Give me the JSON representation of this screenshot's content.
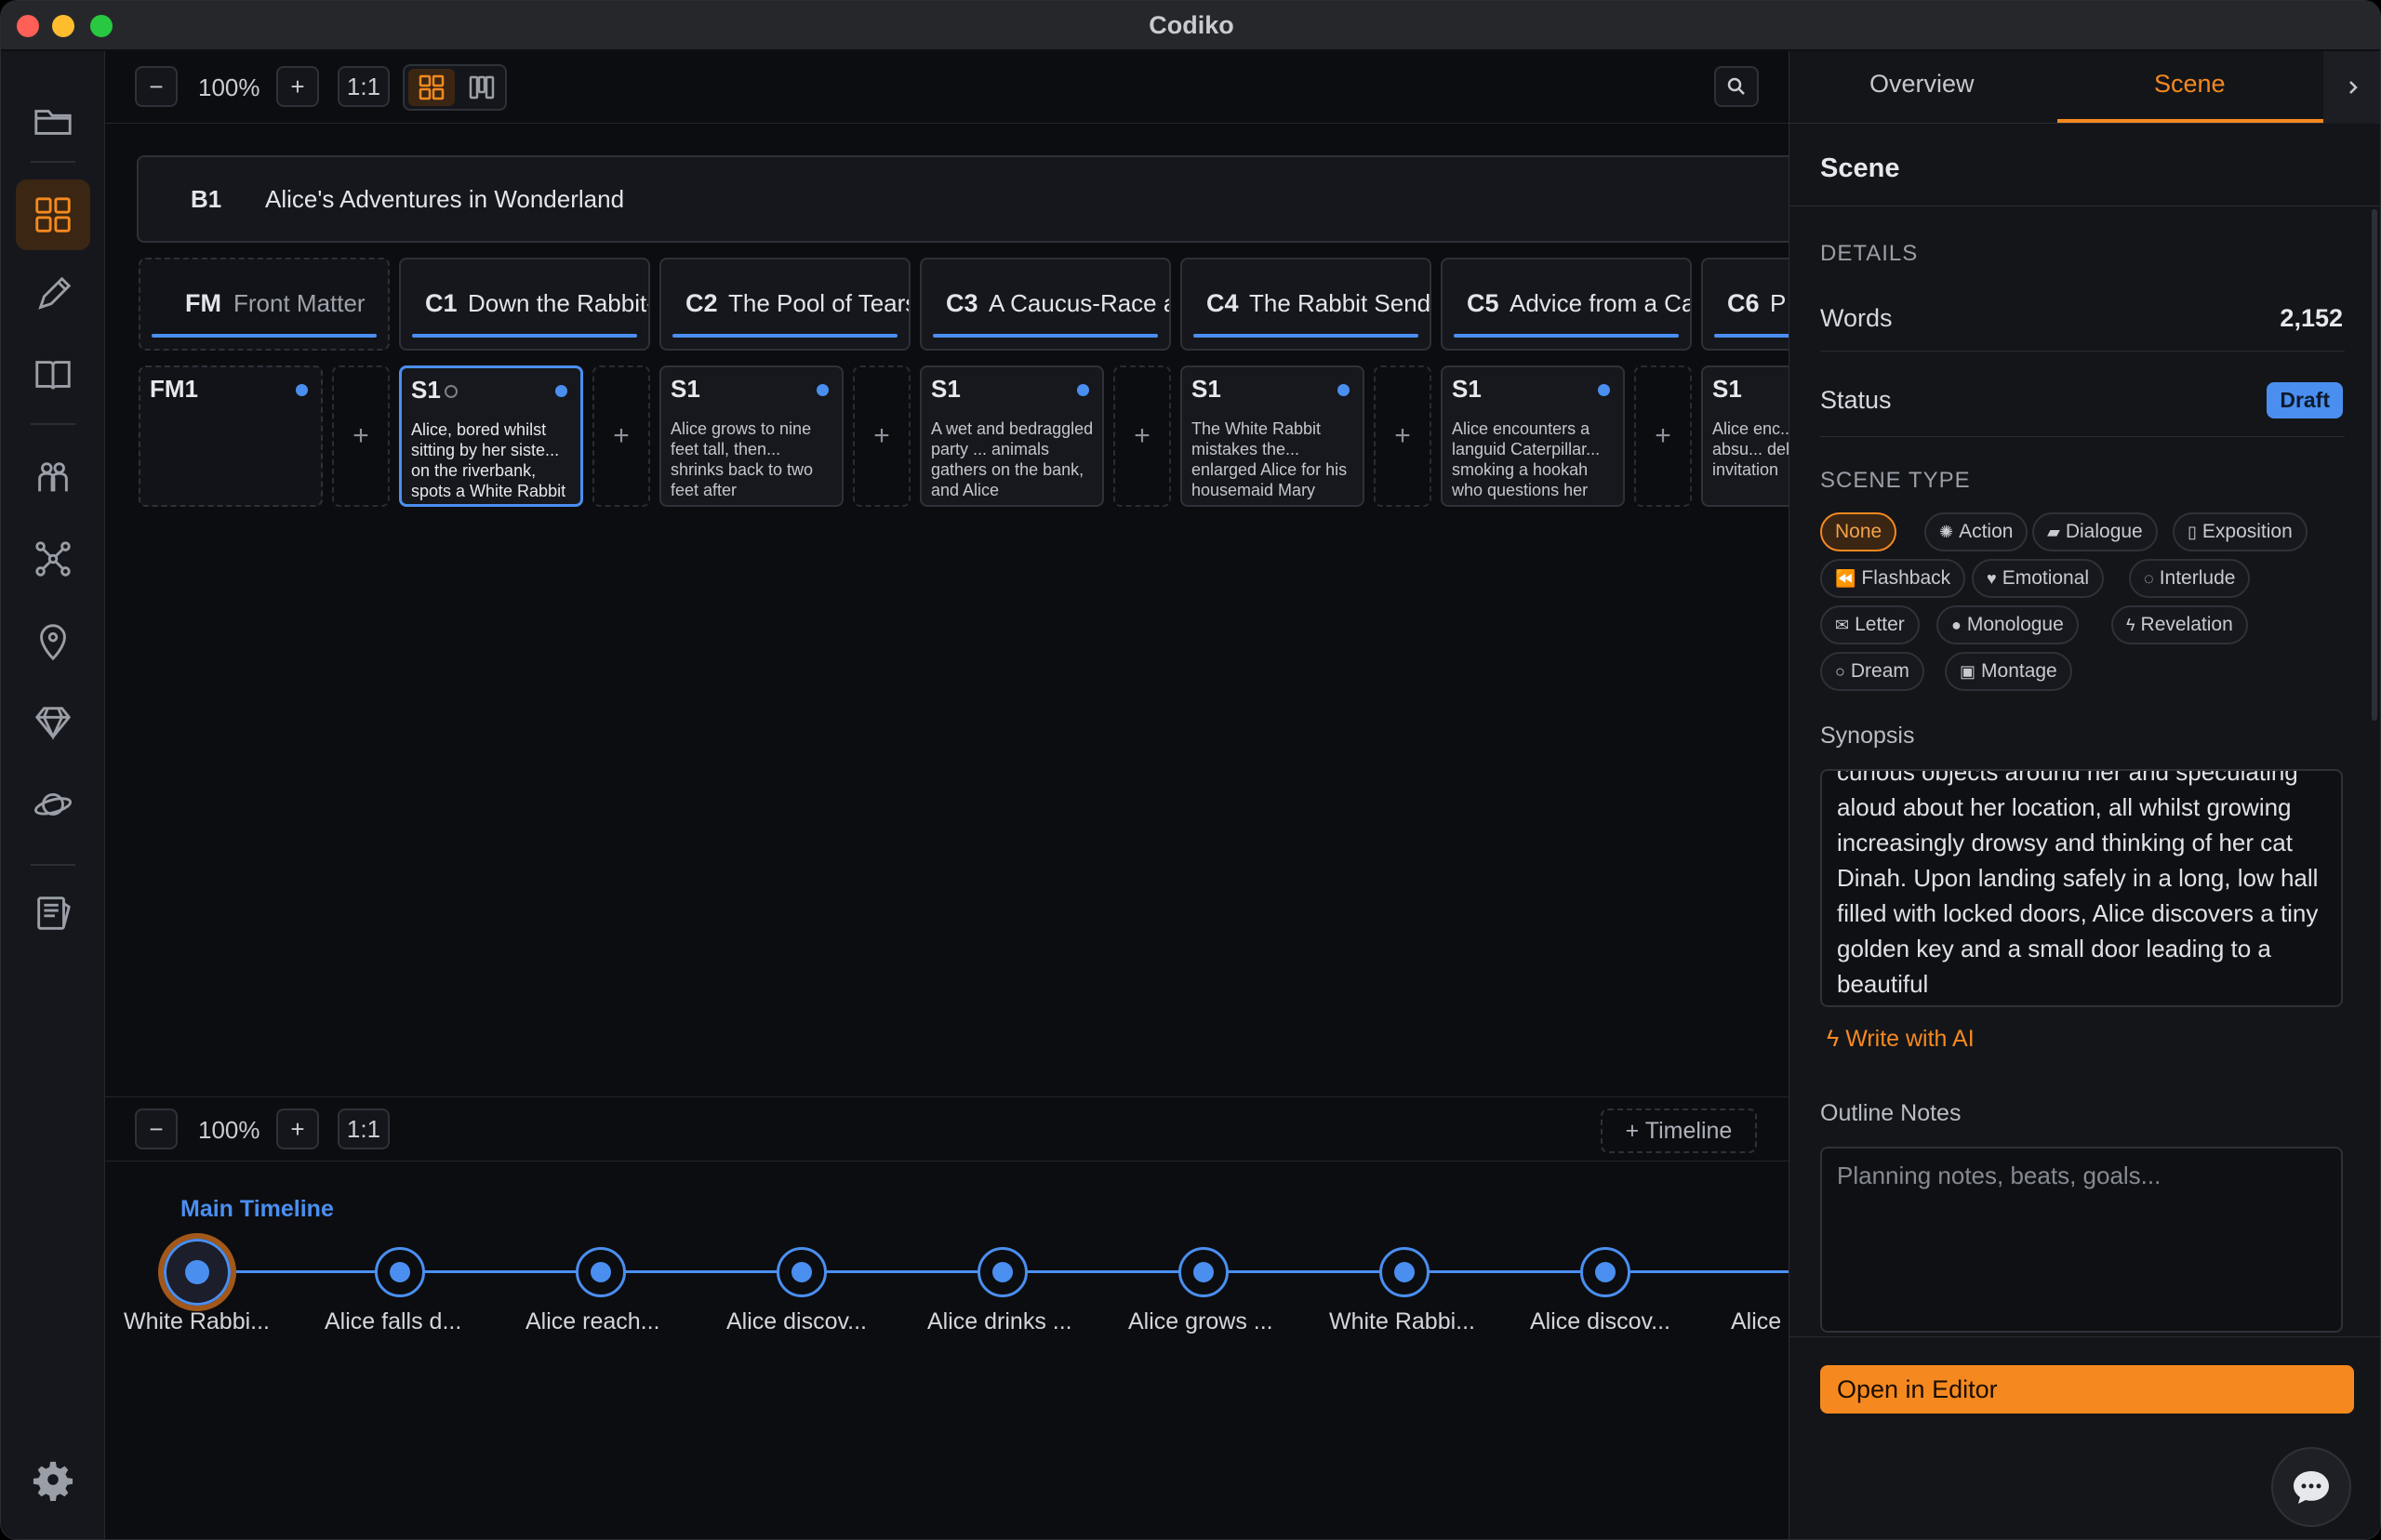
{
  "app": {
    "title": "Codiko"
  },
  "sidebar": {
    "items": [
      {
        "icon": "folder-icon"
      },
      {
        "icon": "grid-icon",
        "active": true
      },
      {
        "icon": "pencil-icon"
      },
      {
        "icon": "book-icon"
      },
      {
        "icon": "characters-icon"
      },
      {
        "icon": "graph-icon"
      },
      {
        "icon": "location-icon"
      },
      {
        "icon": "gem-icon"
      },
      {
        "icon": "planet-icon"
      },
      {
        "icon": "notes-icon"
      },
      {
        "icon": "settings-icon"
      }
    ]
  },
  "toolbar": {
    "zoom_out": "−",
    "zoom": "100%",
    "zoom_in": "+",
    "reset": "1:1"
  },
  "book": {
    "tag": "B1",
    "title": "Alice's Adventures in Wonderland"
  },
  "chapters": [
    {
      "tag": "FM",
      "title": "Front Matter"
    },
    {
      "tag": "C1",
      "title": "Down the Rabbit-Hole"
    },
    {
      "tag": "C2",
      "title": "The Pool of Tears"
    },
    {
      "tag": "C3",
      "title": "A Caucus-Race and a Long Tale"
    },
    {
      "tag": "C4",
      "title": "The Rabbit Sends in a Little Bill"
    },
    {
      "tag": "C5",
      "title": "Advice from a Caterpillar"
    },
    {
      "tag": "C6",
      "title": "P"
    }
  ],
  "scenes": [
    {
      "tag": "FM1",
      "text": ""
    },
    {
      "tag": "S1",
      "text": "Alice, bored whilst sitting by her siste... on the riverbank, spots a White Rabbit"
    },
    {
      "tag": "S1",
      "text": "Alice grows to nine feet tall, then... shrinks back to two feet after"
    },
    {
      "tag": "S1",
      "text": "A wet and bedraggled party ... animals gathers on the bank, and Alice"
    },
    {
      "tag": "S1",
      "text": "The White Rabbit mistakes the... enlarged Alice for his housemaid Mary"
    },
    {
      "tag": "S1",
      "text": "Alice encounters a languid Caterpillar... smoking a hookah who questions her"
    },
    {
      "tag": "S1",
      "text": "Alice enc... two absu... delivering invitation"
    }
  ],
  "adder_label": "+",
  "bottom": {
    "zoom_out": "−",
    "zoom": "100%",
    "zoom_in": "+",
    "reset": "1:1",
    "add_timeline": "+ Timeline"
  },
  "timeline": {
    "title": "Main Timeline",
    "events": [
      "White Rabbi...",
      "Alice falls d...",
      "Alice reach...",
      "Alice discov...",
      "Alice drinks ...",
      "Alice grows ...",
      "White Rabbi...",
      "Alice discov...",
      "Alice"
    ]
  },
  "panel": {
    "tabs": [
      "Overview",
      "Scene"
    ],
    "title": "Scene",
    "details_label": "DETAILS",
    "words_label": "Words",
    "words_value": "2,152",
    "status_label": "Status",
    "status_value": "Draft",
    "scene_type_label": "SCENE TYPE",
    "scene_types": [
      {
        "label": "None",
        "icon": ""
      },
      {
        "label": "Action",
        "icon": "✺"
      },
      {
        "label": "Dialogue",
        "icon": "▰"
      },
      {
        "label": "Exposition",
        "icon": "▯"
      },
      {
        "label": "Flashback",
        "icon": "⏪"
      },
      {
        "label": "Emotional",
        "icon": "♥"
      },
      {
        "label": "Interlude",
        "icon": "◌"
      },
      {
        "label": "Letter",
        "icon": "✉"
      },
      {
        "label": "Monologue",
        "icon": "●"
      },
      {
        "label": "Revelation",
        "icon": "ϟ"
      },
      {
        "label": "Dream",
        "icon": "○"
      },
      {
        "label": "Montage",
        "icon": "▣"
      }
    ],
    "synopsis_label": "Synopsis",
    "synopsis_text": "curious objects around her and speculating aloud about her location, all whilst growing increasingly drowsy and thinking of her cat Dinah. Upon landing safely in a long, low hall filled with locked doors, Alice discovers a tiny golden key and a small door leading to a beautiful",
    "write_ai": "Write with AI",
    "outline_label": "Outline Notes",
    "outline_placeholder": "Planning notes, beats, goals...",
    "open_editor": "Open in Editor"
  },
  "colors": {
    "accent": "#f5891f",
    "blue": "#4a8ff0",
    "bg": "#0c0d11",
    "panel": "#141519"
  }
}
